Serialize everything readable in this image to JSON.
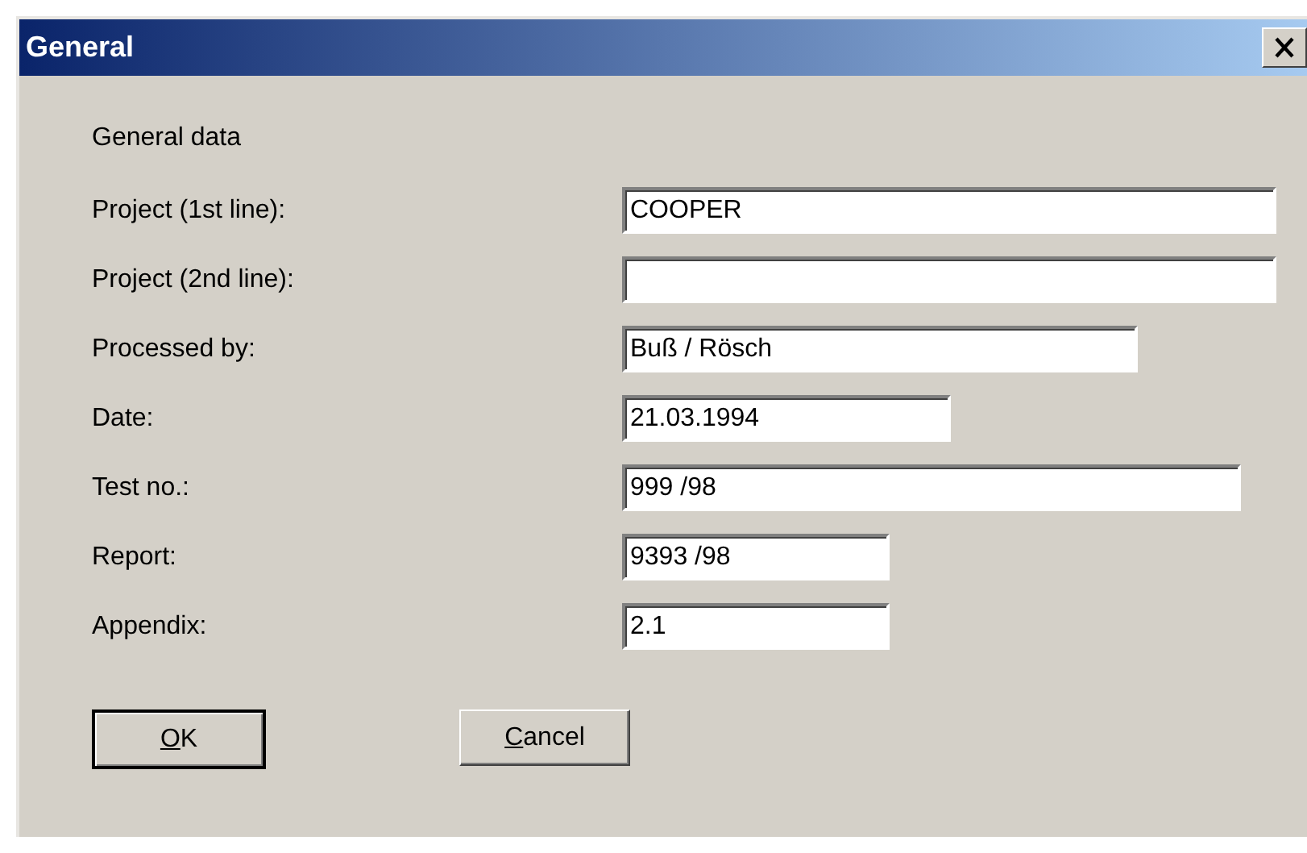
{
  "window": {
    "title": "General"
  },
  "section_title": "General data",
  "fields": [
    {
      "label": "Project (1st line):",
      "value": "COOPER"
    },
    {
      "label": "Project (2nd line):"
    },
    {
      "label": "Processed by:",
      "value": "Buß / Rösch"
    },
    {
      "label": "Date:",
      "value": "21.03.1994"
    },
    {
      "label": "Test no.:",
      "value": "999 /98"
    },
    {
      "label": "Report:",
      "value": "9393 /98"
    },
    {
      "label": "Appendix:",
      "value": "2.1"
    }
  ],
  "buttons": [
    {
      "label": "OK",
      "default": true
    },
    {
      "label": "Cancel",
      "default": false
    }
  ]
}
